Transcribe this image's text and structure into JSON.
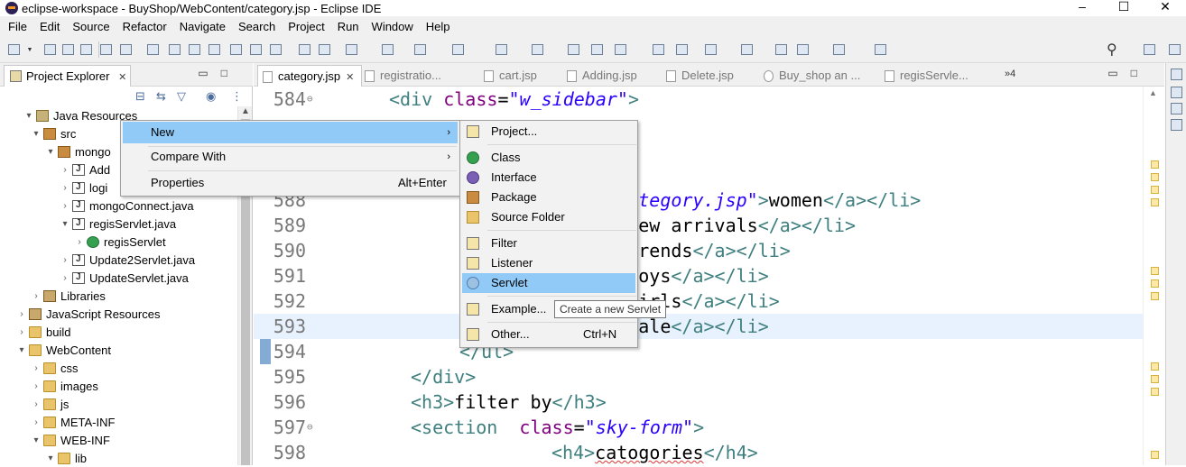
{
  "window": {
    "title": "eclipse-workspace - BuyShop/WebContent/category.jsp - Eclipse IDE",
    "controls": [
      "–",
      "☐",
      "✕"
    ]
  },
  "menubar": [
    "File",
    "Edit",
    "Source",
    "Refactor",
    "Navigate",
    "Search",
    "Project",
    "Run",
    "Window",
    "Help"
  ],
  "explorer": {
    "tab_label": "Project Explorer",
    "tab_close": "✕",
    "tree": [
      {
        "label": "Java Resources",
        "twisty": "▾",
        "icon": "proj"
      },
      {
        "label": "src",
        "twisty": "▾",
        "icon": "pkg"
      },
      {
        "label": "mongo",
        "twisty": "▾",
        "icon": "pkg"
      },
      {
        "label": "Add",
        "twisty": "›",
        "icon": "java"
      },
      {
        "label": "logi",
        "twisty": "›",
        "icon": "java"
      },
      {
        "label": "mongoConnect.java",
        "twisty": "›",
        "icon": "java"
      },
      {
        "label": "regisServlet.java",
        "twisty": "▾",
        "icon": "java"
      },
      {
        "label": "regisServlet",
        "twisty": "›",
        "icon": "cls"
      },
      {
        "label": "Update2Servlet.java",
        "twisty": "›",
        "icon": "java"
      },
      {
        "label": "UpdateServlet.java",
        "twisty": "›",
        "icon": "java"
      },
      {
        "label": "Libraries",
        "twisty": "›",
        "icon": "lib"
      },
      {
        "label": "JavaScript Resources",
        "twisty": "›",
        "icon": "lib"
      },
      {
        "label": "build",
        "twisty": "›",
        "icon": "folder"
      },
      {
        "label": "WebContent",
        "twisty": "▾",
        "icon": "folder"
      },
      {
        "label": "css",
        "twisty": "›",
        "icon": "folder"
      },
      {
        "label": "images",
        "twisty": "›",
        "icon": "folder"
      },
      {
        "label": "js",
        "twisty": "›",
        "icon": "folder"
      },
      {
        "label": "META-INF",
        "twisty": "›",
        "icon": "folder"
      },
      {
        "label": "WEB-INF",
        "twisty": "▾",
        "icon": "folder"
      },
      {
        "label": "lib",
        "twisty": "▾",
        "icon": "folder"
      }
    ]
  },
  "editor": {
    "tabs": [
      "category.jsp",
      "registratio...",
      "cart.jsp",
      "Adding.jsp",
      "Delete.jsp",
      "Buy_shop an ...",
      "regisServle..."
    ],
    "overflow_count": "»4",
    "lines": [
      {
        "num": "584",
        "fold": "⊖"
      },
      {
        "num": ""
      },
      {
        "num": ""
      },
      {
        "num": ""
      },
      {
        "num": "588"
      },
      {
        "num": "589"
      },
      {
        "num": "590"
      },
      {
        "num": "591"
      },
      {
        "num": "592"
      },
      {
        "num": "593"
      },
      {
        "num": "594"
      },
      {
        "num": "595"
      },
      {
        "num": "596"
      },
      {
        "num": "597",
        "fold": "⊖"
      },
      {
        "num": "598"
      }
    ],
    "code": {
      "l584": [
        "<div ",
        "class",
        "=",
        "\"w_sidebar\"",
        ">"
      ],
      "l585_tail": ">",
      "l588": [
        "=",
        "\"wocategory.jsp\"",
        ">",
        "women",
        "</a></li>"
      ],
      "l589": [
        "=",
        "\"#\"",
        ">",
        "new arrivals",
        "</a></li>"
      ],
      "l590": [
        "=",
        "\"#\"",
        ">",
        "trends",
        "</a></li>"
      ],
      "l591": [
        "=",
        "\"#\"",
        ">",
        "boys",
        "</a></li>"
      ],
      "l592": [
        "=",
        "\"#\"",
        ">",
        "girls",
        "</a></li>"
      ],
      "l593": [
        "=",
        "\"#\"",
        ">",
        "sale",
        "</a><",
        "/li>"
      ],
      "l594": "</ul>",
      "l595": "</div>",
      "l596": [
        "<h3>",
        "filter by",
        "</h3>"
      ],
      "l597": [
        "<section  ",
        "class",
        "=",
        "\"sky-form\"",
        ">"
      ],
      "l598": [
        "<h4>",
        "catogories",
        "</h4>"
      ]
    }
  },
  "context_menu": {
    "items": [
      {
        "label": "New",
        "arrow": "›",
        "highlight": true
      },
      {
        "label": "Compare With",
        "arrow": "›"
      },
      {
        "label": "Properties",
        "shortcut": "Alt+Enter"
      }
    ]
  },
  "submenu": {
    "items": [
      {
        "label": "Project...",
        "icon": "project-icon"
      },
      {
        "label": "Class",
        "icon": "class-icon"
      },
      {
        "label": "Interface",
        "icon": "interface-icon"
      },
      {
        "label": "Package",
        "icon": "package-icon"
      },
      {
        "label": "Source Folder",
        "icon": "source-folder-icon"
      },
      {
        "label": "Filter",
        "icon": "filter-icon"
      },
      {
        "label": "Listener",
        "icon": "listener-icon"
      },
      {
        "label": "Servlet",
        "icon": "servlet-icon",
        "highlight": true
      },
      {
        "label": "Example...",
        "icon": "example-icon"
      },
      {
        "label": "Other...",
        "icon": "other-icon",
        "shortcut": "Ctrl+N"
      }
    ]
  },
  "tooltip": "Create a new Servlet",
  "colors": {
    "highlight": "#91c9f7",
    "tag": "#3f7f7f",
    "attr": "#7f007f",
    "string": "#2a00ff",
    "current_line": "#e8f2fe"
  }
}
